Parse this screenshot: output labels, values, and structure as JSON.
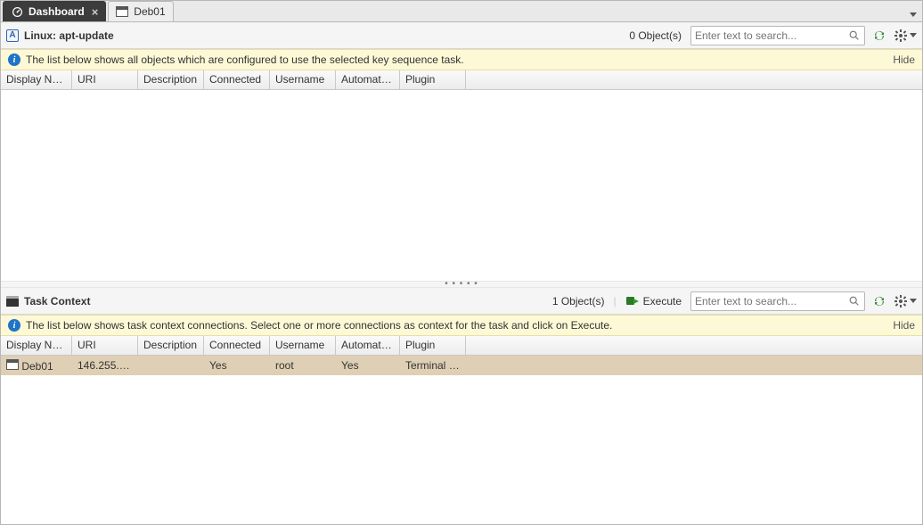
{
  "tabs": {
    "dashboard": "Dashboard",
    "deb01": "Deb01"
  },
  "upper": {
    "title": "Linux: apt-update",
    "count": "0 Object(s)",
    "search_placeholder": "Enter text to search...",
    "info": "The list below shows all objects which are configured to use the selected key sequence task.",
    "hide": "Hide",
    "columns": {
      "display": "Display Na...",
      "uri": "URI",
      "desc": "Description",
      "conn": "Connected",
      "user": "Username",
      "auto": "Automatic...",
      "plugin": "Plugin"
    }
  },
  "lower": {
    "title": "Task Context",
    "count": "1 Object(s)",
    "execute": "Execute",
    "search_placeholder": "Enter text to search...",
    "info": "The list below shows task context connections. Select one or more connections as context for the task and click on Execute.",
    "hide": "Hide",
    "columns": {
      "display": "Display Na...",
      "uri": "URI",
      "desc": "Description",
      "conn": "Connected",
      "user": "Username",
      "auto": "Automatic...",
      "plugin": "Plugin"
    },
    "row": {
      "display": "Deb01",
      "uri": "146.255.56....",
      "desc": "",
      "conn": "Yes",
      "user": "root",
      "auto": "Yes",
      "plugin": "Terminal (..."
    }
  }
}
